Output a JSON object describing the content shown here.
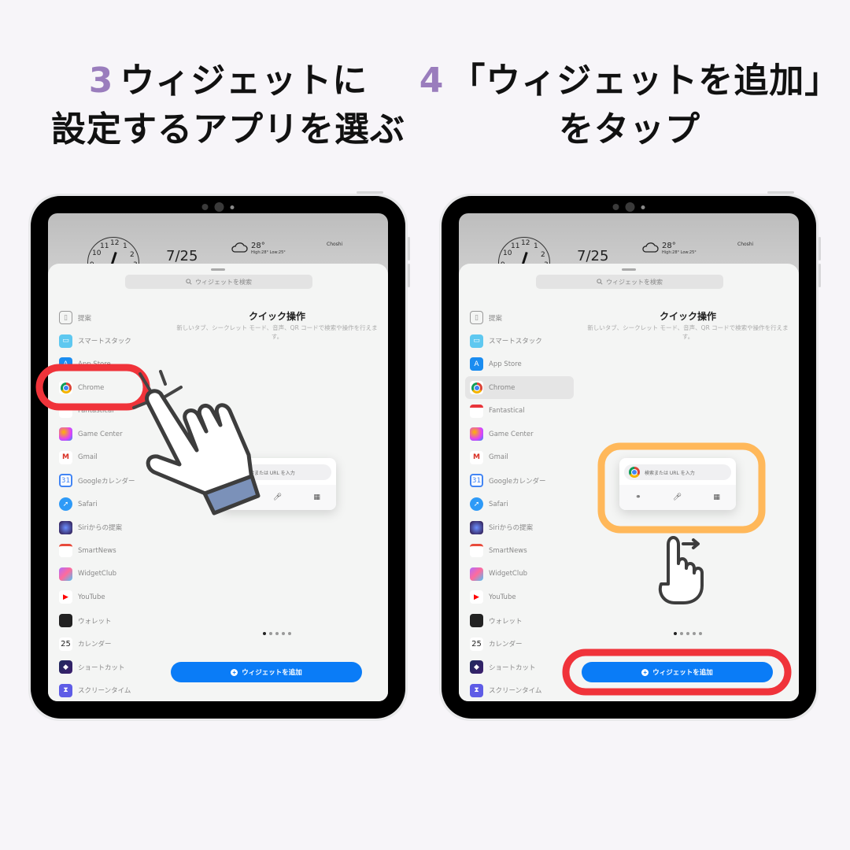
{
  "steps": [
    {
      "number": "3",
      "title_line1": "ウィジェットに",
      "title_line2": "設定するアプリを選ぶ"
    },
    {
      "number": "4",
      "title_line1": "「ウィジェットを追加」",
      "title_line2": "をタップ"
    }
  ],
  "colors": {
    "step_number": "#9a7dbd",
    "highlight_red": "#f0333a",
    "highlight_orange": "#ffb85a",
    "button_blue": "#0a7cf7",
    "cuff_blue": "#7b91b9"
  },
  "home_screen": {
    "date": "7/25",
    "temperature": "28°",
    "high_low": "High:28° Low:25°",
    "city": "Choshi"
  },
  "widget_gallery": {
    "search_placeholder": "ウィジェットを検索",
    "apps": [
      {
        "label": "提案",
        "icon": "suggestions-icon"
      },
      {
        "label": "スマートスタック",
        "icon": "smart-stack-icon"
      },
      {
        "label": "App Store",
        "icon": "app-store-icon"
      },
      {
        "label": "Chrome",
        "icon": "chrome-icon"
      },
      {
        "label": "Fantastical",
        "icon": "fantastical-icon"
      },
      {
        "label": "Game Center",
        "icon": "game-center-icon"
      },
      {
        "label": "Gmail",
        "icon": "gmail-icon"
      },
      {
        "label": "Googleカレンダー",
        "icon": "google-calendar-icon"
      },
      {
        "label": "Safari",
        "icon": "safari-icon"
      },
      {
        "label": "Siriからの提案",
        "icon": "siri-icon"
      },
      {
        "label": "SmartNews",
        "icon": "smartnews-icon"
      },
      {
        "label": "WidgetClub",
        "icon": "widgetclub-icon"
      },
      {
        "label": "YouTube",
        "icon": "youtube-icon"
      },
      {
        "label": "ウォレット",
        "icon": "wallet-icon"
      },
      {
        "label": "カレンダー",
        "icon": "calendar-icon"
      },
      {
        "label": "ショートカット",
        "icon": "shortcuts-icon"
      },
      {
        "label": "スクリーンタイム",
        "icon": "screen-time-icon"
      }
    ],
    "selected_app": "Chrome",
    "widget_title": "クイック操作",
    "widget_description": "新しいタブ、シークレット モード、音声、QR コードで検索や操作を行えます。",
    "preview_search_text": "検索または URL を入力",
    "page_count": 5,
    "current_page": 1,
    "add_button_label": "ウィジェットを追加"
  }
}
